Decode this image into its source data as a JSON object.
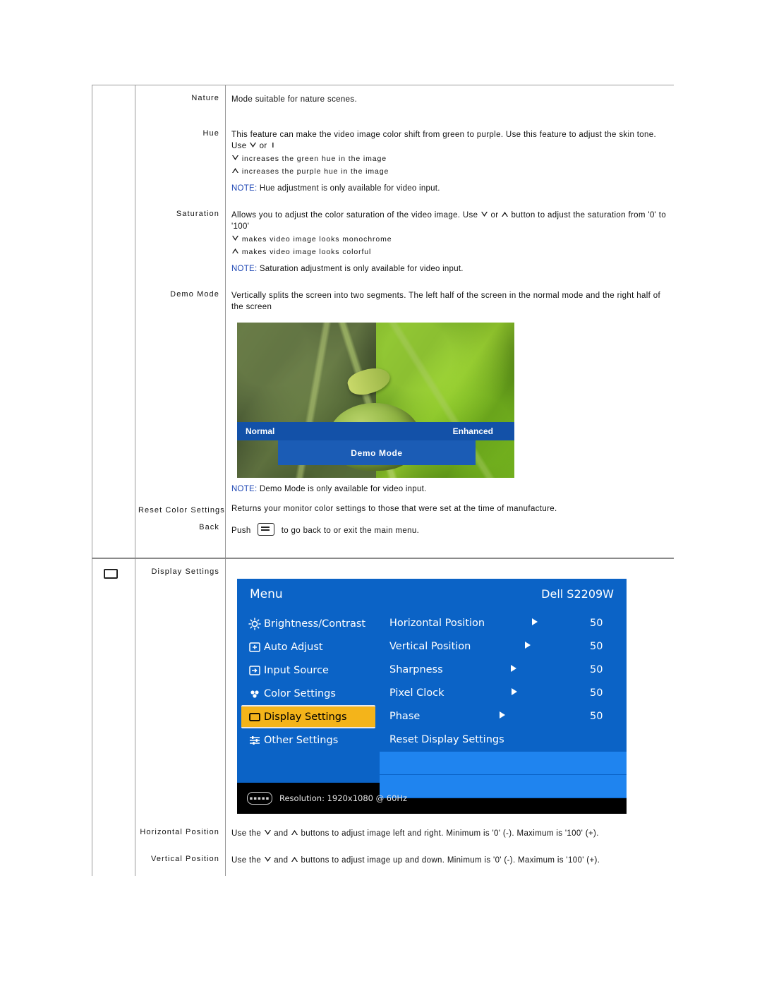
{
  "sections": [
    {
      "label": "Nature",
      "body": "Mode suitable for nature scenes."
    },
    {
      "label": "Hue",
      "body": "This feature can make the video image color shift from green to purple. Use this feature to adjust the skin tone. Use",
      "body_tail_or": "or",
      "sub1": "increases the green hue in the image",
      "sub2": "increases the purple hue in the image",
      "note_word": "NOTE:",
      "note_text": "Hue adjustment is only available for video input."
    },
    {
      "label": "Saturation",
      "body_a": "Allows you to adjust the color saturation of the video image. Use",
      "body_or": "or",
      "body_b": "button to adjust the saturation from '0' to '100'",
      "sub1": "makes video image looks monochrome",
      "sub2": "makes video image looks colorful",
      "note_word": "NOTE:",
      "note_text": "Saturation adjustment is only available for video input."
    },
    {
      "label": "Demo Mode",
      "body": "Vertically splits the screen into two segments. The left half of the screen in the normal mode and the right half of the screen",
      "image": {
        "left_label": "Normal",
        "right_label": "Enhanced",
        "bottom_label": "Demo  Mode"
      },
      "note_word": "NOTE:",
      "note_text": "Demo Mode is only available for video input."
    },
    {
      "label": "Reset Color Settings",
      "body": "Returns your monitor color settings to those that were set at the time of manufacture."
    },
    {
      "label": "Back",
      "push_word": "Push",
      "push_tail": "to go back to or exit the main menu."
    }
  ],
  "display_section": {
    "label": "Display Settings",
    "icon_name": "display-settings-icon",
    "osd": {
      "title": "Menu",
      "model": "Dell S2209W",
      "menu_items": [
        {
          "label": "Brightness/Contrast",
          "icon": "brightness-icon",
          "selected": false
        },
        {
          "label": "Auto Adjust",
          "icon": "auto-adjust-icon",
          "selected": false
        },
        {
          "label": "Input Source",
          "icon": "input-source-icon",
          "selected": false
        },
        {
          "label": "Color Settings",
          "icon": "color-settings-icon",
          "selected": false
        },
        {
          "label": "Display Settings",
          "icon": "display-settings-icon",
          "selected": true
        },
        {
          "label": "Other Settings",
          "icon": "other-settings-icon",
          "selected": false
        }
      ],
      "sub_items": [
        {
          "label": "Horizontal Position",
          "value": "50",
          "arrow": true
        },
        {
          "label": "Vertical Position",
          "value": "50",
          "arrow": true
        },
        {
          "label": "Sharpness",
          "value": "50",
          "arrow": true
        },
        {
          "label": "Pixel Clock",
          "value": "50",
          "arrow": true
        },
        {
          "label": "Phase",
          "value": "50",
          "arrow": true
        },
        {
          "label": "Reset Display Settings",
          "value": "",
          "arrow": false
        }
      ],
      "footer": "Resolution: 1920x1080 @ 60Hz",
      "footer_icon": "vga-connector-icon",
      "colors": {
        "blue": "#0b63c6",
        "highlight": "#f4b41a",
        "row_alt": "#1f84ef"
      }
    },
    "rows": [
      {
        "label": "Horizontal Position",
        "pre": "Use the",
        "mid": "and",
        "post": "buttons to adjust image left and right. Minimum is '0' (-). Maximum is '100' (+)."
      },
      {
        "label": "Vertical Position",
        "pre": "Use the",
        "mid": "and",
        "post": "buttons to adjust image up and down. Minimum is '0' (-). Maximum is '100' (+)."
      }
    ]
  }
}
